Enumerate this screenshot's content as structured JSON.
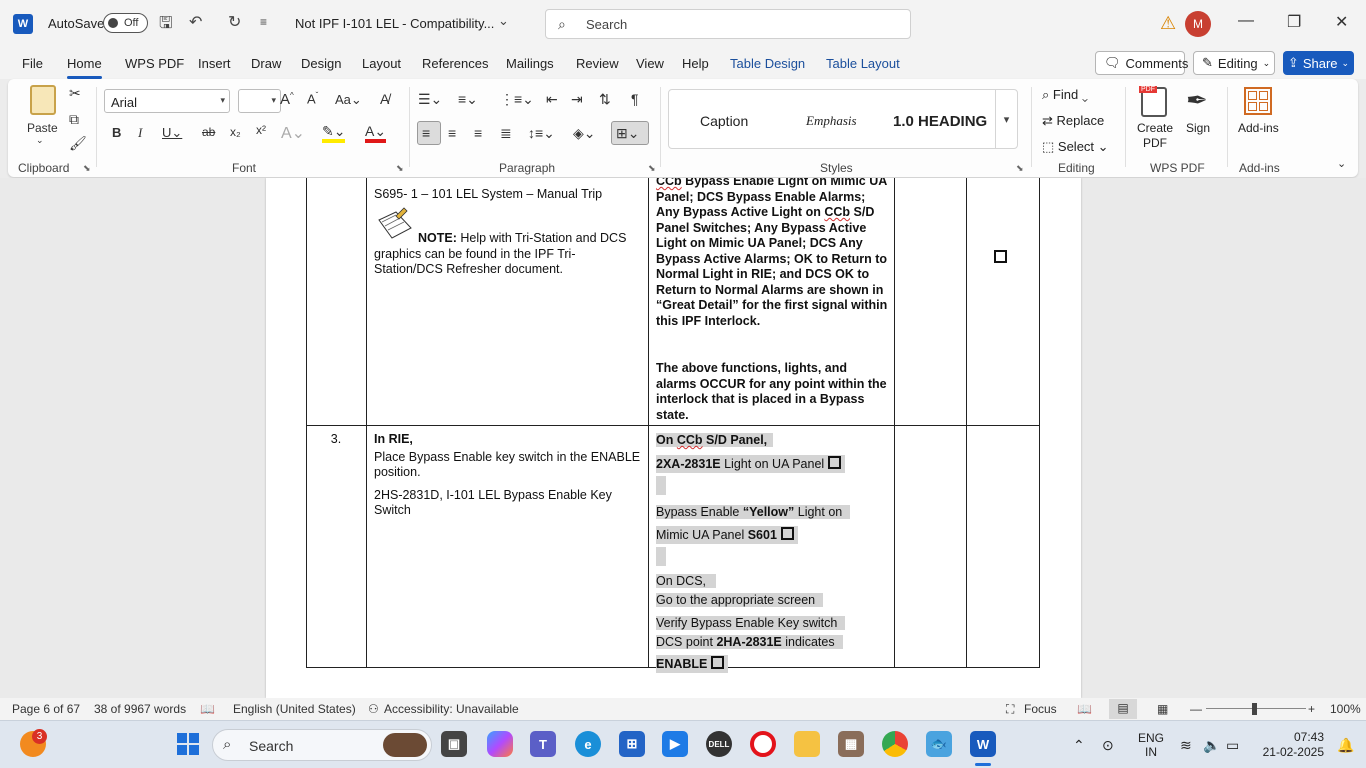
{
  "titlebar": {
    "app_logo": "W",
    "autosave_label": "AutoSave",
    "autosave_state": "Off",
    "doc_title": "Not IPF I-101 LEL  -  Compatibility...",
    "search_placeholder": "Search",
    "avatar_initial": "M"
  },
  "menu": {
    "tabs": [
      "File",
      "Home",
      "WPS PDF",
      "Insert",
      "Draw",
      "Design",
      "Layout",
      "References",
      "Mailings",
      "Review",
      "View",
      "Help",
      "Table Design",
      "Table Layout"
    ],
    "comments_label": "Comments",
    "editing_label": "Editing",
    "share_label": "Share"
  },
  "ribbon": {
    "clipboard": {
      "paste_label": "Paste",
      "group_label": "Clipboard"
    },
    "font": {
      "font_name": "Arial",
      "font_size": "",
      "group_label": "Font"
    },
    "paragraph": {
      "group_label": "Paragraph"
    },
    "styles": {
      "items": [
        "Caption",
        "Emphasis",
        "1.0  HEADING"
      ],
      "group_label": "Styles"
    },
    "editing": {
      "find": "Find",
      "replace": "Replace",
      "select": "Select",
      "group_label": "Editing"
    },
    "wps": {
      "create_pdf": "Create PDF",
      "sign": "Sign",
      "group_label": "WPS PDF"
    },
    "addins": {
      "label": "Add-ins",
      "group_label": "Add-ins"
    }
  },
  "document": {
    "row_top": {
      "left_lines": [
        "S695- 1 – 101 LEL System – Manual Trip"
      ],
      "note_label": "NOTE:",
      "note_text": " Help with Tri-Station and DCS graphics can be found in the IPF Tri-Station/DCS Refresher document.",
      "right_squiggle": "CCb",
      "right_text_1": " Bypass Enable Light on Mimic UA Panel; DCS Bypass Enable Alarms; Any Bypass Active Light on ",
      "right_squiggle_2": "CCb",
      "right_text_2": " S/D Panel Switches; Any Bypass Active Light on Mimic UA Panel; DCS Any Bypass Active Alarms; OK to Return to Normal Light in RIE; and DCS OK to Return to Normal Alarms are shown in “Great Detail” for the first signal within this IPF Interlock.",
      "right_para_2": "The above functions, lights, and alarms OCCUR for any point within the interlock that is placed in a Bypass state."
    },
    "row_3": {
      "step_number": "3.",
      "heading": "In RIE,",
      "instruction": "Place Bypass Enable key switch in the ENABLE position.",
      "switch_desc": "2HS-2831D, I-101 LEL Bypass Enable Key Switch",
      "on_panel_prefix": "On ",
      "on_panel_squiggle": "CCb",
      "on_panel_suffix": " S/D Panel,",
      "xa_tag": "2XA-2831E",
      "xa_text": " Light on UA Panel",
      "bypass_text_1": "Bypass Enable ",
      "bypass_yellow": "“Yellow”",
      "bypass_text_2": " Light on",
      "mimic_text": "Mimic UA Panel ",
      "mimic_tag": "S601",
      "on_dcs": "On DCS,",
      "goto_screen": "Go to the appropriate screen",
      "verify_line": "Verify Bypass Enable Key switch",
      "dcs_point_prefix": "DCS point ",
      "dcs_point_tag": "2HA-2831E",
      "dcs_point_suffix": " indicates",
      "enable_word": "ENABLE"
    }
  },
  "statusbar": {
    "page": "Page 6 of 67",
    "words": "38 of 9967 words",
    "language": "English (United States)",
    "accessibility": "Accessibility: Unavailable",
    "focus": "Focus",
    "zoom": "100%"
  },
  "taskbar": {
    "notification_count": "3",
    "search_label": "Search",
    "lang_line1": "ENG",
    "lang_line2": "IN",
    "time": "07:43",
    "date": "21-02-2025"
  },
  "colors": {
    "accent": "#185abd",
    "highlight": "#d4d4d4",
    "avatar": "#c83f31"
  }
}
